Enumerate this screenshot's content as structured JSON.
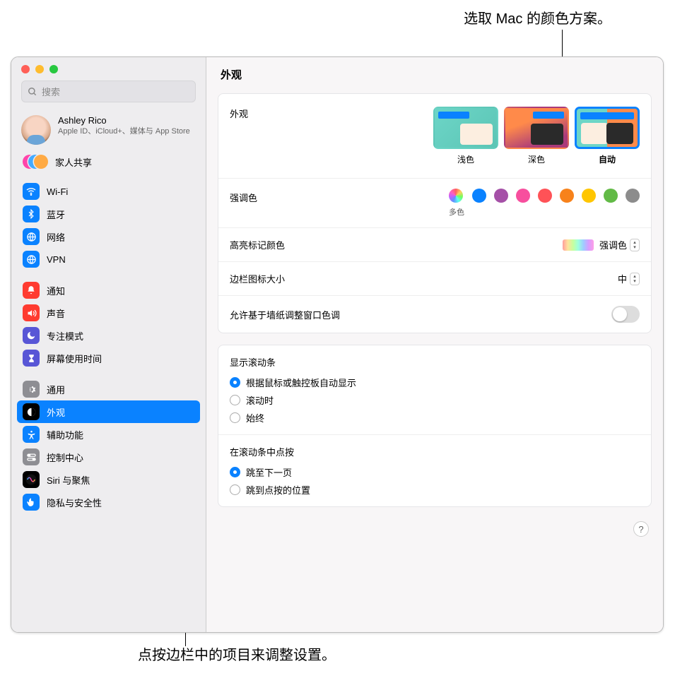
{
  "annotations": {
    "top": "选取 Mac 的颜色方案。",
    "bottom": "点按边栏中的项目来调整设置。"
  },
  "search": {
    "placeholder": "搜索"
  },
  "user": {
    "name": "Ashley Rico",
    "sub": "Apple ID、iCloud+、媒体与 App Store"
  },
  "family": {
    "label": "家人共享"
  },
  "sidebar": {
    "items": [
      {
        "label": "Wi-Fi",
        "color": "#0a82ff",
        "glyph": "wifi"
      },
      {
        "label": "蓝牙",
        "color": "#0a82ff",
        "glyph": "bluetooth"
      },
      {
        "label": "网络",
        "color": "#0a82ff",
        "glyph": "globe"
      },
      {
        "label": "VPN",
        "color": "#0a82ff",
        "glyph": "globe"
      },
      {
        "gap": true
      },
      {
        "label": "通知",
        "color": "#ff3b30",
        "glyph": "bell"
      },
      {
        "label": "声音",
        "color": "#ff3b30",
        "glyph": "sound"
      },
      {
        "label": "专注模式",
        "color": "#5856d6",
        "glyph": "moon"
      },
      {
        "label": "屏幕使用时间",
        "color": "#5856d6",
        "glyph": "hourglass"
      },
      {
        "gap": true
      },
      {
        "label": "通用",
        "color": "#8e8e93",
        "glyph": "gear"
      },
      {
        "label": "外观",
        "color": "#000000",
        "glyph": "appearance",
        "selected": true
      },
      {
        "label": "辅助功能",
        "color": "#0a82ff",
        "glyph": "accessibility"
      },
      {
        "label": "控制中心",
        "color": "#8e8e93",
        "glyph": "switches"
      },
      {
        "label": "Siri 与聚焦",
        "color": "siri",
        "glyph": "siri"
      },
      {
        "label": "隐私与安全性",
        "color": "#0a82ff",
        "glyph": "hand"
      }
    ]
  },
  "header": {
    "title": "外观"
  },
  "appearance": {
    "label": "外观",
    "options": [
      {
        "label": "浅色",
        "kind": "light"
      },
      {
        "label": "深色",
        "kind": "dark"
      },
      {
        "label": "自动",
        "kind": "auto",
        "selected": true
      }
    ]
  },
  "accent": {
    "label": "强调色",
    "multicolor_label": "多色",
    "colors": [
      {
        "value": "multicolor",
        "bg": "conic-gradient(#ff5f5f,#ffcf5f,#6fff5f,#5fffef,#5f8fff,#bf5fff,#ff5fbf,#ff5f5f)"
      },
      {
        "value": "blue",
        "bg": "#0a82ff"
      },
      {
        "value": "purple",
        "bg": "#a550a7"
      },
      {
        "value": "pink",
        "bg": "#f74f9e"
      },
      {
        "value": "red",
        "bg": "#ff5257"
      },
      {
        "value": "orange",
        "bg": "#f7821b"
      },
      {
        "value": "yellow",
        "bg": "#ffc600"
      },
      {
        "value": "green",
        "bg": "#62ba46"
      },
      {
        "value": "graphite",
        "bg": "#8c8c8c"
      }
    ]
  },
  "highlight": {
    "label": "高亮标记颜色",
    "value": "强调色"
  },
  "sidebarSize": {
    "label": "边栏图标大小",
    "value": "中"
  },
  "tint": {
    "label": "允许基于墙纸调整窗口色调"
  },
  "scrollbars": {
    "title": "显示滚动条",
    "options": [
      {
        "label": "根据鼠标或触控板自动显示",
        "checked": true
      },
      {
        "label": "滚动时"
      },
      {
        "label": "始终"
      }
    ]
  },
  "scrollClick": {
    "title": "在滚动条中点按",
    "options": [
      {
        "label": "跳至下一页",
        "checked": true
      },
      {
        "label": "跳到点按的位置"
      }
    ]
  },
  "help": {
    "label": "?"
  }
}
